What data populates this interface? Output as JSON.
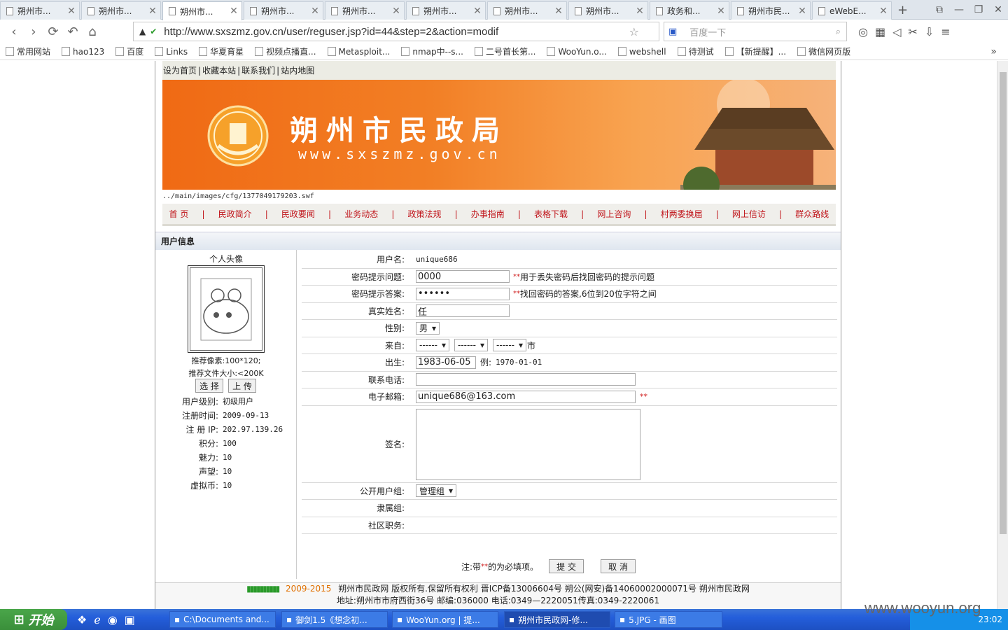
{
  "tabs": [
    "朔州市...",
    "朔州市...",
    "朔州市...",
    "朔州市...",
    "朔州市...",
    "朔州市...",
    "朔州市...",
    "朔州市...",
    "政务和...",
    "朔州市民...",
    "eWebE..."
  ],
  "active_tab_index": 2,
  "browser": {
    "url": "http://www.sxszmz.gov.cn/user/reguser.jsp?id=44&step=2&action=modif",
    "search_placeholder": "百度一下"
  },
  "bookmarks": [
    "常用网站",
    "hao123",
    "百度",
    "Links",
    "华夏育星",
    "视频点播直...",
    "Metasploit...",
    "nmap中--s...",
    "二号首长第...",
    "WooYun.o...",
    "webshell",
    "待测试",
    "【新提醒】...",
    "微信网页版"
  ],
  "site": {
    "top_links": [
      "设为首页",
      "收藏本站",
      "联系我们",
      "站内地图"
    ],
    "banner_title": "朔州市民政局",
    "banner_url": "www.sxszmz.gov.cn",
    "flash_path": "../main/images/cfg/1377049179203.swf",
    "menu": [
      "首 页",
      "民政简介",
      "民政要闻",
      "业务动态",
      "政策法规",
      "办事指南",
      "表格下载",
      "网上咨询",
      "村两委换届",
      "网上信访",
      "群众路线"
    ]
  },
  "section_title": "用户信息",
  "left": {
    "avatar_label": "个人头像",
    "recommend_pixels": "推荐像素:100*120;",
    "recommend_size": "推荐文件大小:<200K",
    "select_button": "选 择",
    "upload_button": "上 传",
    "stats": [
      {
        "label": "用户级别:",
        "value": "初级用户"
      },
      {
        "label": "注册时间:",
        "value": "2009-09-13"
      },
      {
        "label": "注 册 IP:",
        "value": "202.97.139.26"
      },
      {
        "label": "积分:",
        "value": "100"
      },
      {
        "label": "魅力:",
        "value": "10"
      },
      {
        "label": "声望:",
        "value": "10"
      },
      {
        "label": "虚拟币:",
        "value": "10"
      }
    ]
  },
  "form": {
    "username_label": "用户名:",
    "username": "unique686",
    "pwq_label": "密码提示问题:",
    "pwq_value": "0000",
    "pwq_hint": "用于丢失密码后找回密码的提示问题",
    "pwa_label": "密码提示答案:",
    "pwa_value": "••••••",
    "pwa_hint": "找回密码的答案,6位到20位字符之间",
    "realname_label": "真实姓名:",
    "realname": "任",
    "gender_label": "性别:",
    "gender": "男",
    "from_label": "来自:",
    "from_select": "------",
    "from_suffix": "市",
    "birth_label": "出生:",
    "birth": "1983-06-05",
    "birth_example_label": "例:",
    "birth_example": "1970-01-01",
    "phone_label": "联系电话:",
    "phone": "",
    "email_label": "电子邮箱:",
    "email": "unique686@163.com",
    "signature_label": "签名:",
    "signature": "",
    "public_group_label": "公开用户组:",
    "public_group": "管理组",
    "belong_group_label": "隶属组:",
    "community_label": "社区职务:",
    "required_mark": "**",
    "note_prefix": "注:带",
    "note_suffix": "的为必填项。",
    "submit": "提 交",
    "cancel": "取 消"
  },
  "footer": {
    "years": "2009-2015",
    "line1": "朔州市民政网 版权所有.保留所有权利 晋ICP备13006604号 朔公(网安)备14060002000071号 朔州市民政网",
    "line2": "地址:朔州市市府西街36号 邮编:036000 电话:0349—2220051传真:0349-2220061"
  },
  "taskbar": {
    "start": "开始",
    "items": [
      "C:\\Documents and...",
      "御剑1.5《想念初...",
      "WooYun.org | 提...",
      "朔州市民政网-修...",
      "5.JPG - 画图"
    ],
    "clock": "23:02"
  },
  "watermark": "www.wooyun.org"
}
